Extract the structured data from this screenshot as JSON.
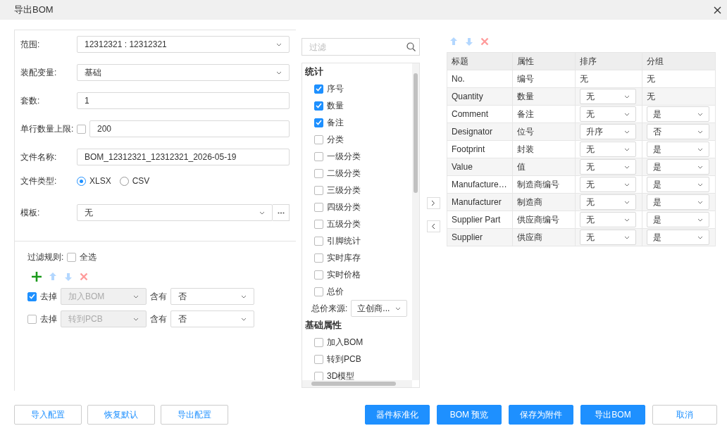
{
  "window": {
    "title": "导出BOM"
  },
  "form": {
    "range": {
      "label": "范围:",
      "value": "12312321 : 12312321"
    },
    "variant": {
      "label": "装配变量:",
      "value": "基础"
    },
    "sets": {
      "label": "套数:",
      "value": "1"
    },
    "row_limit": {
      "label": "单行数量上限:",
      "checked": false,
      "value": "200"
    },
    "file_name": {
      "label": "文件名称:",
      "value": "BOM_12312321_12312321_2026-05-19"
    },
    "file_type": {
      "label": "文件类型:",
      "options": [
        {
          "label": "XLSX",
          "selected": true
        },
        {
          "label": "CSV",
          "selected": false
        }
      ]
    },
    "template": {
      "label": "模板:",
      "value": "无"
    }
  },
  "filter_rules": {
    "label": "过滤规则:",
    "select_all": {
      "label": "全选",
      "checked": false
    },
    "rules": [
      {
        "checked": true,
        "action": "去掉",
        "field": "加入BOM",
        "field_disabled": true,
        "op": "含有",
        "value": "否"
      },
      {
        "checked": false,
        "action": "去掉",
        "field": "转到PCB",
        "field_disabled": true,
        "op": "含有",
        "value": "否"
      }
    ]
  },
  "fields": {
    "placeholder": "过滤",
    "groups": [
      {
        "title": "统计",
        "items": [
          {
            "kind": "checkbox",
            "label": "序号",
            "checked": true
          },
          {
            "kind": "checkbox",
            "label": "数量",
            "checked": true
          },
          {
            "kind": "checkbox",
            "label": "备注",
            "checked": true
          },
          {
            "kind": "checkbox",
            "label": "分类",
            "checked": false
          },
          {
            "kind": "checkbox",
            "label": "一级分类",
            "checked": false
          },
          {
            "kind": "checkbox",
            "label": "二级分类",
            "checked": false
          },
          {
            "kind": "checkbox",
            "label": "三级分类",
            "checked": false
          },
          {
            "kind": "checkbox",
            "label": "四级分类",
            "checked": false
          },
          {
            "kind": "checkbox",
            "label": "五级分类",
            "checked": false
          },
          {
            "kind": "checkbox",
            "label": "引脚统计",
            "checked": false
          },
          {
            "kind": "checkbox",
            "label": "实时库存",
            "checked": false
          },
          {
            "kind": "checkbox",
            "label": "实时价格",
            "checked": false
          },
          {
            "kind": "checkbox",
            "label": "总价",
            "checked": false
          },
          {
            "kind": "select",
            "label": "总价来源:",
            "value": "立创商..."
          }
        ]
      },
      {
        "title": "基础属性",
        "items": [
          {
            "kind": "checkbox",
            "label": "加入BOM",
            "checked": false
          },
          {
            "kind": "checkbox",
            "label": "转到PCB",
            "checked": false
          },
          {
            "kind": "checkbox",
            "label": "3D模型",
            "checked": false
          }
        ]
      }
    ]
  },
  "table": {
    "columns": [
      "标题",
      "属性",
      "排序",
      "分组"
    ],
    "rows": [
      {
        "title": "No.",
        "attribute": "编号",
        "sort": {
          "kind": "text",
          "value": "无"
        },
        "group": {
          "kind": "text",
          "value": "无"
        }
      },
      {
        "title": "Quantity",
        "attribute": "数量",
        "sort": {
          "kind": "select",
          "value": "无"
        },
        "group": {
          "kind": "text",
          "value": "无"
        }
      },
      {
        "title": "Comment",
        "attribute": "备注",
        "sort": {
          "kind": "select",
          "value": "无"
        },
        "group": {
          "kind": "select",
          "value": "是"
        }
      },
      {
        "title": "Designator",
        "attribute": "位号",
        "sort": {
          "kind": "select",
          "value": "升序"
        },
        "group": {
          "kind": "select",
          "value": "否"
        }
      },
      {
        "title": "Footprint",
        "attribute": "封装",
        "sort": {
          "kind": "select",
          "value": "无"
        },
        "group": {
          "kind": "select",
          "value": "是"
        }
      },
      {
        "title": "Value",
        "attribute": "值",
        "sort": {
          "kind": "select",
          "value": "无"
        },
        "group": {
          "kind": "select",
          "value": "是"
        }
      },
      {
        "title": "Manufacture…",
        "attribute": "制造商编号",
        "sort": {
          "kind": "select",
          "value": "无"
        },
        "group": {
          "kind": "select",
          "value": "是"
        }
      },
      {
        "title": "Manufacturer",
        "attribute": "制造商",
        "sort": {
          "kind": "select",
          "value": "无"
        },
        "group": {
          "kind": "select",
          "value": "是"
        }
      },
      {
        "title": "Supplier Part",
        "attribute": "供应商编号",
        "sort": {
          "kind": "select",
          "value": "无"
        },
        "group": {
          "kind": "select",
          "value": "是"
        }
      },
      {
        "title": "Supplier",
        "attribute": "供应商",
        "sort": {
          "kind": "select",
          "value": "无"
        },
        "group": {
          "kind": "select",
          "value": "是"
        }
      }
    ]
  },
  "config_buttons": [
    "导入配置",
    "恢复默认",
    "导出配置"
  ],
  "action_buttons": [
    {
      "label": "器件标准化",
      "kind": "primary"
    },
    {
      "label": "BOM 预览",
      "kind": "primary"
    },
    {
      "label": "保存为附件",
      "kind": "primary"
    },
    {
      "label": "导出BOM",
      "kind": "primary"
    },
    {
      "label": "取消",
      "kind": "default"
    }
  ]
}
